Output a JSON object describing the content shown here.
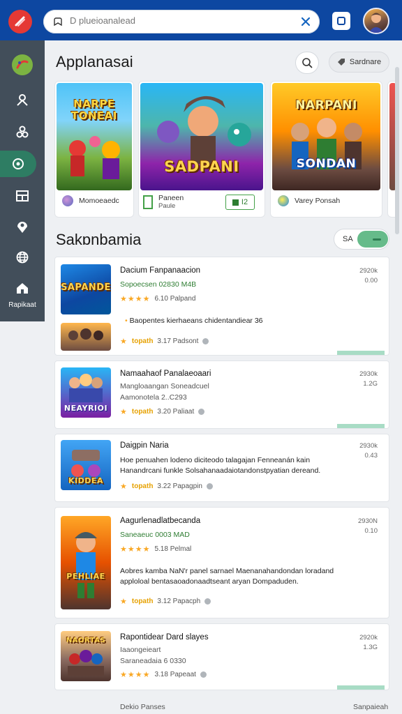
{
  "topbar": {
    "search_placeholder": "D plueioanalead",
    "brand_color": "#0d47a1"
  },
  "sidebar": {
    "bottom_label": "Rapikaat",
    "items": [
      {
        "icon": "palette-icon"
      },
      {
        "icon": "person-icon"
      },
      {
        "icon": "people-icon"
      },
      {
        "icon": "target-icon",
        "active": true
      },
      {
        "icon": "grid-icon"
      },
      {
        "icon": "location-icon"
      },
      {
        "icon": "globe-icon"
      },
      {
        "icon": "home-icon"
      }
    ]
  },
  "featured": {
    "title": "Applanasai",
    "filter_button": "Sardnare",
    "items": [
      {
        "art": "NARPE TONEAI",
        "caption": "Momoeaedc"
      },
      {
        "art": "SADPANI",
        "caption": "Paneen",
        "caption2": "Paule",
        "badge": "I2"
      },
      {
        "art": "SONDAN",
        "caption": "Varey Ponsah"
      }
    ]
  },
  "section2": {
    "title": "Sakɒnbamia",
    "toggle_label": "SA"
  },
  "cards": [
    {
      "title": "Dacium Fanpanaacion",
      "subtitle": "Sopoecsen 02830 M4B",
      "rating1": "6.10  Palpand",
      "desc": "Baopentes kierhaeans chidentandiear 36",
      "tag": "topath",
      "rating2": "3.17  Padsont",
      "rt1": "2920k",
      "rt2": "0.00",
      "thumb_art": "SAPANDE"
    },
    {
      "title": "Namaahaof Panalaeoaari",
      "subtitle": "Mangloaangan Soneadcuel",
      "subtitle2": "Aamonotela 2..C293",
      "tag": "topath",
      "rating2": "3.20  Paliaat",
      "rt1": "2930k",
      "rt2": "1.2G",
      "thumb_art": "NEAYRIOI"
    },
    {
      "title": "Daigpin Naria",
      "desc": "Hoe penuahen lodeno diciteodo talagajan Fenneanán kain Hanandrcani funkle Solsahanaadaiotandonstpyatian dereand.",
      "tag": "topath",
      "rating2": "3.22  Papagpin",
      "rt1": "2930k",
      "rt2": "0.43",
      "thumb_art": "KIDDEA"
    },
    {
      "title": "Aagurlenadlatbecanda",
      "subtitle": "Saneaeuc 0003 MAD",
      "rating1": "5.18  Pelmal",
      "desc": "Aobres kamba NaN'r panel sarnael Maenanahandondan loradand apploloal bentasaoadonaadtseant aryan Dompaduden.",
      "tag": "topath",
      "rating2": "3.12  Papacph",
      "rt1": "2930N",
      "rt2": "0.10",
      "thumb_art": "PEHLIAE"
    },
    {
      "title": "Rapontidear Dard slayes",
      "subtitle": "Iaaongeieart",
      "subtitle2": "Saraneadaia 6 0330",
      "rating1": "3.18  Papeaat",
      "rt1": "2920k",
      "rt2": "1.3G",
      "thumb_art": "NAORTAS"
    }
  ],
  "footer": {
    "left": "Dekio Panses",
    "right": "Sanpaieah"
  }
}
